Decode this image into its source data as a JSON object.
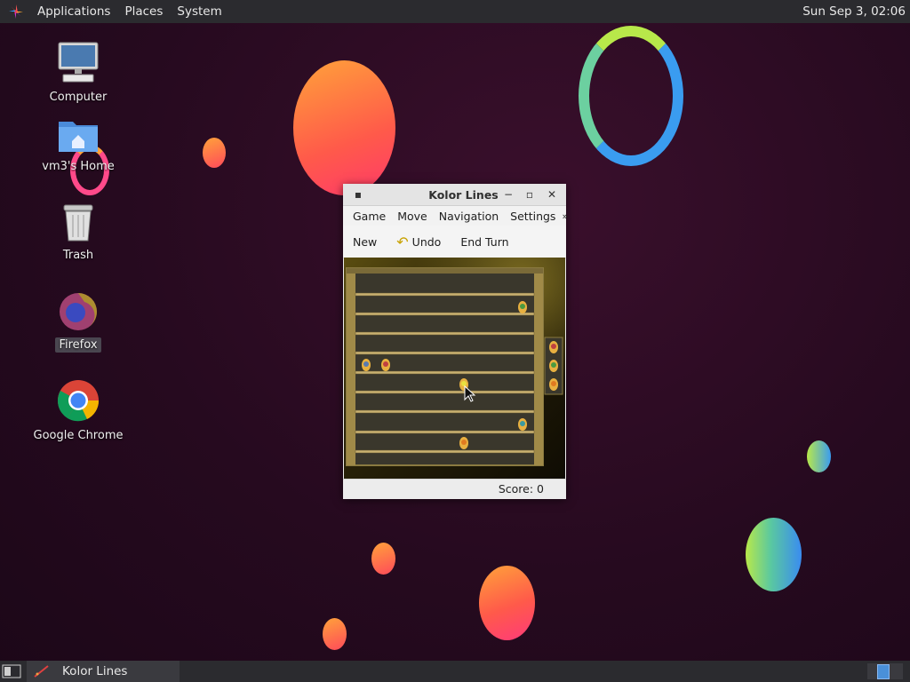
{
  "top_panel": {
    "menus": [
      "Applications",
      "Places",
      "System"
    ],
    "clock": "Sun Sep  3, 02:06"
  },
  "desktop": {
    "icons": [
      {
        "label": "Computer",
        "icon": "computer-icon"
      },
      {
        "label": "vm3's Home",
        "icon": "home-folder-icon"
      },
      {
        "label": "Trash",
        "icon": "trash-icon"
      },
      {
        "label": "Firefox",
        "icon": "firefox-icon"
      },
      {
        "label": "Google Chrome",
        "icon": "chrome-icon"
      }
    ]
  },
  "window": {
    "title": "Kolor Lines",
    "menu": [
      "Game",
      "Move",
      "Navigation",
      "Settings"
    ],
    "toolbar": {
      "new": "New",
      "undo": "Undo",
      "end_turn": "End Turn"
    },
    "score": "Score: 0"
  },
  "taskbar": {
    "task_label": "Kolor Lines"
  },
  "colors": {
    "panel": "#2b2b2f",
    "desktop_bg": "#260a1f"
  }
}
